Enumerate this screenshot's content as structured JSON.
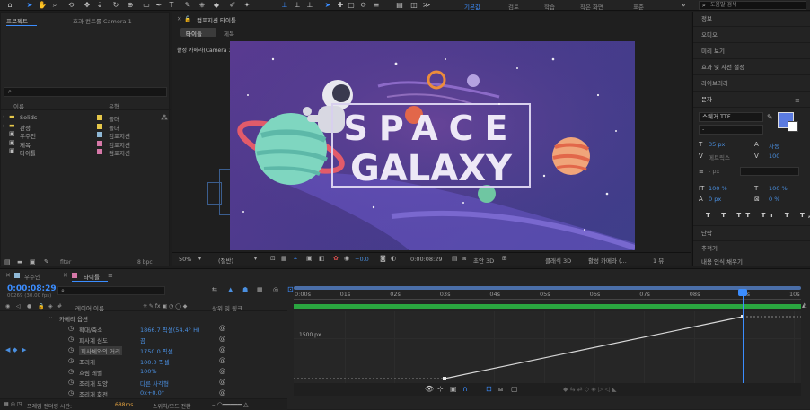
{
  "workspaces": [
    "기본값",
    "검토",
    "학습",
    "작은 화면",
    "표준"
  ],
  "active_workspace": "기본값",
  "search_placeholder": "도움말 검색",
  "project": {
    "tab_project": "프로젝트",
    "tab_effect": "효과 컨트롤 Camera 1",
    "col_name": "이름",
    "col_type": "유형",
    "items": [
      {
        "name": "Solids",
        "type": "폴더",
        "color": "#e6c84a"
      },
      {
        "name": "관성",
        "type": "폴더",
        "color": "#e6c84a"
      },
      {
        "name": "우주인",
        "type": "컴포지션",
        "color": "#8fb8d6"
      },
      {
        "name": "제목",
        "type": "컴포지션",
        "color": "#d678a8"
      },
      {
        "name": "타이틀",
        "type": "컴포지션",
        "color": "#d678a8"
      }
    ],
    "footer_bpc": "8 bpc"
  },
  "composition": {
    "header": "컴포지션 타이틀",
    "breadcrumb_active": "타이틀",
    "breadcrumb_next": "제목",
    "active_camera": "활성 카메라(Camera 1)",
    "title_line1": "SPACE",
    "title_line2": "GALAXY",
    "zoom": "50%",
    "resolution": "(절반)",
    "exposure": "+0.0",
    "timecode": "0:00:08:29",
    "renderer": "클래식 3D",
    "view": "활성 카메라 (...",
    "views_count": "1 뷰",
    "draft_3d": "초안 3D"
  },
  "right_panel": {
    "items": [
      "정보",
      "오디오",
      "미리 보기",
      "효과 및 사전 설정",
      "라이브러리"
    ],
    "char_label": "문자",
    "font": "스웨거 TTF",
    "font_size": "35 px",
    "tracking": "자동",
    "kerning_label": "메트릭스",
    "kerning_value": "100",
    "stroke_label": "- px",
    "scale_v": "100 %",
    "scale_h": "100 %",
    "baseline": "0 px",
    "tsume": "0 %",
    "paragraph": "단락",
    "tracker": "추적기",
    "more": "내용 인식 채우기"
  },
  "timeline": {
    "tab_astronaut": "우주인",
    "tab_title": "타이틀",
    "current_time": "0:00:08:29",
    "fps": "00269 (30.00 fps)",
    "col_layer_name": "레이어 이름",
    "col_parent": "상위 및 링크",
    "group": "카메라 옵션",
    "props": [
      {
        "name": "확대/축소",
        "value": "1866.7 픽셀(54.4° H)"
      },
      {
        "name": "피사계 심도",
        "value": "끔"
      },
      {
        "name": "피사체와의 거리",
        "value": "1750.0 픽셀"
      },
      {
        "name": "조리개",
        "value": "100.0 픽셀"
      },
      {
        "name": "흐림 레벨",
        "value": "100%"
      },
      {
        "name": "조리개 모양",
        "value": "다른 사각형"
      },
      {
        "name": "조리개 회전",
        "value": "0x+0.0°"
      }
    ],
    "ruler": [
      "0:00s",
      "01s",
      "02s",
      "03s",
      "04s",
      "05s",
      "06s",
      "07s",
      "08s",
      "09s",
      "10s"
    ],
    "graph_label": "1500 px",
    "render_time_label": "프레임 렌더링 시간:",
    "render_time_value": "688ms",
    "switches_label": "스위치/모드 전환"
  }
}
